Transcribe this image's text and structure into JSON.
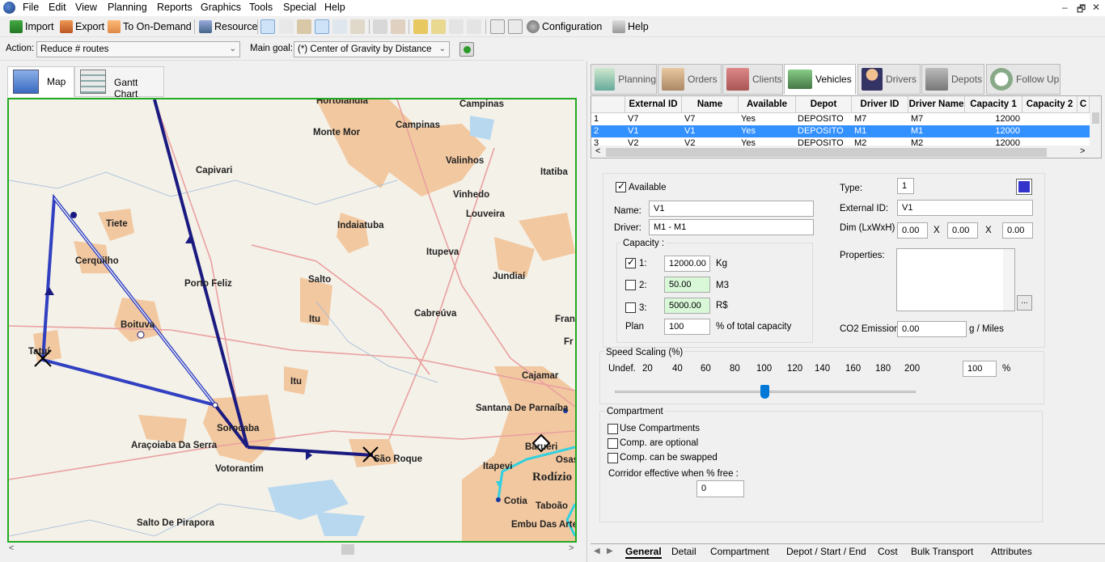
{
  "menu": [
    "File",
    "Edit",
    "View",
    "Planning",
    "Reports",
    "Graphics",
    "Tools",
    "Special",
    "Help"
  ],
  "window_controls": [
    "–",
    "🗗",
    "✕"
  ],
  "toolbar": {
    "import_label": "Import",
    "export_label": "Export",
    "on_demand_label": "To On-Demand",
    "resource_label": "Resource",
    "configuration_label": "Configuration",
    "help_label": "Help"
  },
  "action_bar": {
    "action_label": "Action:",
    "action_value": "Reduce # routes",
    "goal_label": "Main goal:",
    "goal_value": "(*) Center of Gravity by Distance"
  },
  "left_tabs": {
    "map": "Map",
    "gantt": "Gantt Chart"
  },
  "map": {
    "cities": [
      "Hortolândia",
      "Campinas",
      "Monte Mor",
      "Campinas",
      "Valinhos",
      "Capivari",
      "Itatiba",
      "Vinhedo",
      "Tiete",
      "Indaiatuba",
      "Louveira",
      "Cerquilho",
      "Itupeva",
      "Porto Feliz",
      "Salto",
      "Jundiaí",
      "Cabreúva",
      "Itu",
      "Boituva",
      "Tatuí",
      "Fran",
      "Fr",
      "Itu",
      "Cajamar",
      "Santana De Parnaíba",
      "Sorocaba",
      "Araçoiaba Da Serra",
      "Barueri",
      "Osasco",
      "Votorantim",
      "São Roque",
      "Itapevi",
      "Rodízio",
      "Cotia",
      "Taboão",
      "Salto De Pirapora",
      "Embu Das Artes"
    ]
  },
  "right_tabs": [
    "Planning",
    "Orders",
    "Clients",
    "Vehicles",
    "Drivers",
    "Depots",
    "Follow Up"
  ],
  "right_active_tab": "Vehicles",
  "grid": {
    "columns": [
      "External ID",
      "Name",
      "Available",
      "Depot",
      "Driver ID",
      "Driver Name",
      "Capacity 1",
      "Capacity 2",
      "C"
    ],
    "rows": [
      {
        "n": "1",
        "ext": "V7",
        "name": "V7",
        "avail": "Yes",
        "depot": "DEPOSITO",
        "drv": "M7",
        "drvname": "M7",
        "cap1": "12000"
      },
      {
        "n": "2",
        "ext": "V1",
        "name": "V1",
        "avail": "Yes",
        "depot": "DEPOSITO",
        "drv": "M1",
        "drvname": "M1",
        "cap1": "12000"
      },
      {
        "n": "3",
        "ext": "V2",
        "name": "V2",
        "avail": "Yes",
        "depot": "DEPOSITO",
        "drv": "M2",
        "drvname": "M2",
        "cap1": "12000"
      }
    ]
  },
  "form": {
    "available_label": "Available",
    "name_label": "Name:",
    "name_value": "V1",
    "driver_label": "Driver:",
    "driver_value": "M1 - M1",
    "capacity_label": "Capacity :",
    "cap1_label": "1:",
    "cap1_value": "12000.00",
    "cap1_unit": "Kg",
    "cap2_label": "2:",
    "cap2_value": "50.00",
    "cap2_unit": "M3",
    "cap3_label": "3:",
    "cap3_value": "5000.00",
    "cap3_unit": "R$",
    "plan_label": "Plan",
    "plan_value": "100",
    "plan_unit": "% of total capacity",
    "type_label": "Type:",
    "type_value": "1",
    "extid_label": "External ID:",
    "extid_value": "V1",
    "dim_label": "Dim (LxWxH) :",
    "dim_l": "0.00",
    "dim_w": "0.00",
    "dim_h": "0.00",
    "dim_x": "X",
    "properties_label": "Properties:",
    "properties_btn": "...",
    "co2_label": "CO2 Emission:",
    "co2_value": "0.00",
    "co2_unit": "g / Miles",
    "vehicle_color": "#3333cc"
  },
  "speed": {
    "title": "Speed Scaling (%)",
    "ticks": [
      "Undef.",
      "20",
      "40",
      "60",
      "80",
      "100",
      "120",
      "140",
      "160",
      "180",
      "200"
    ],
    "value": "100",
    "unit": "%",
    "slider_level_percent": 100
  },
  "compartment": {
    "title": "Compartment",
    "use": "Use Compartments",
    "optional": "Comp. are optional",
    "swapped": "Comp. can be swapped",
    "corridor_label": "Corridor effective when % free :",
    "corridor_value": "0"
  },
  "bottom_tabs": [
    "General",
    "Detail",
    "Compartment",
    "Depot / Start / End",
    "Cost",
    "Bulk Transport",
    "Attributes"
  ],
  "colors": {
    "route_main": "#1a1a80",
    "route_light": "#3040c0",
    "route_cyan": "#30d0e0",
    "urban": "#f2c8a0",
    "accent": "#3390ff"
  }
}
